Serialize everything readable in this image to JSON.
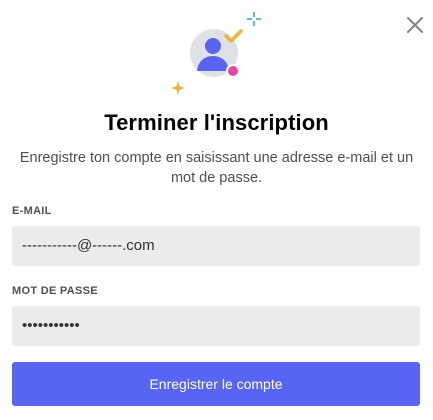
{
  "modal": {
    "close_icon": "close-icon",
    "illustration_icon": "user-avatar-check-icon",
    "title": "Terminer l'inscription",
    "subtitle": "Enregistre ton compte en saisissant une adresse e-mail et un mot de passe."
  },
  "form": {
    "email": {
      "label": "E-MAIL",
      "value": "-----------@------.com"
    },
    "password": {
      "label": "MOT DE PASSE",
      "value": "•••••••••••"
    },
    "submit_label": "Enregistrer le compte"
  },
  "colors": {
    "accent": "#5865f2",
    "avatar_blue": "#5865f2",
    "check_yellow": "#f0b232",
    "status_pink": "#eb459f",
    "sparkle_teal": "#23a8c9"
  }
}
